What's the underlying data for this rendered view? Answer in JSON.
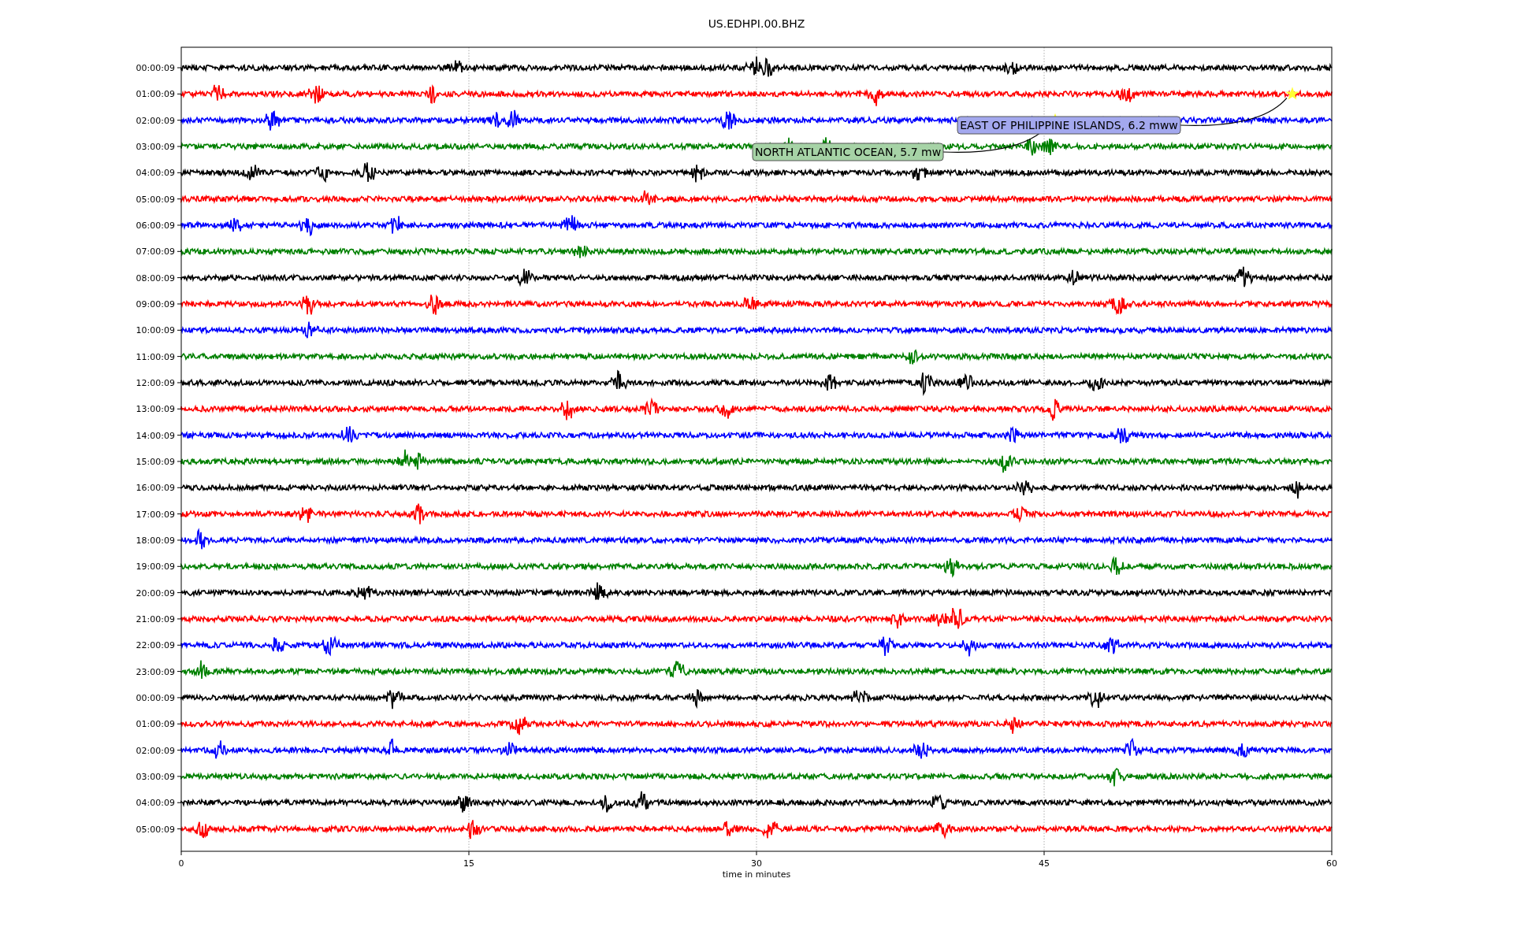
{
  "title": "US.EDHPI.00.BHZ",
  "xlabel": "time in minutes",
  "xticks": [
    "0",
    "15",
    "30",
    "45",
    "60"
  ],
  "rows": [
    {
      "label": "00:00:09",
      "color": "#000000"
    },
    {
      "label": "01:00:09",
      "color": "#ff0000"
    },
    {
      "label": "02:00:09",
      "color": "#0000ff"
    },
    {
      "label": "03:00:09",
      "color": "#008000"
    },
    {
      "label": "04:00:09",
      "color": "#000000"
    },
    {
      "label": "05:00:09",
      "color": "#ff0000"
    },
    {
      "label": "06:00:09",
      "color": "#0000ff"
    },
    {
      "label": "07:00:09",
      "color": "#008000"
    },
    {
      "label": "08:00:09",
      "color": "#000000"
    },
    {
      "label": "09:00:09",
      "color": "#ff0000"
    },
    {
      "label": "10:00:09",
      "color": "#0000ff"
    },
    {
      "label": "11:00:09",
      "color": "#008000"
    },
    {
      "label": "12:00:09",
      "color": "#000000"
    },
    {
      "label": "13:00:09",
      "color": "#ff0000"
    },
    {
      "label": "14:00:09",
      "color": "#0000ff"
    },
    {
      "label": "15:00:09",
      "color": "#008000"
    },
    {
      "label": "16:00:09",
      "color": "#000000"
    },
    {
      "label": "17:00:09",
      "color": "#ff0000"
    },
    {
      "label": "18:00:09",
      "color": "#0000ff"
    },
    {
      "label": "19:00:09",
      "color": "#008000"
    },
    {
      "label": "20:00:09",
      "color": "#000000"
    },
    {
      "label": "21:00:09",
      "color": "#ff0000"
    },
    {
      "label": "22:00:09",
      "color": "#0000ff"
    },
    {
      "label": "23:00:09",
      "color": "#008000"
    },
    {
      "label": "00:00:09",
      "color": "#000000"
    },
    {
      "label": "01:00:09",
      "color": "#ff0000"
    },
    {
      "label": "02:00:09",
      "color": "#0000ff"
    },
    {
      "label": "03:00:09",
      "color": "#008000"
    },
    {
      "label": "04:00:09",
      "color": "#000000"
    },
    {
      "label": "05:00:09",
      "color": "#ff0000"
    }
  ],
  "annotations": [
    {
      "text": "EAST OF PHILIPPINE ISLANDS, 6.2 mww",
      "color": "#a3a8ee"
    },
    {
      "text": "NORTH ATLANTIC OCEAN, 5.7 mw",
      "color": "#a6d3a6"
    }
  ]
}
